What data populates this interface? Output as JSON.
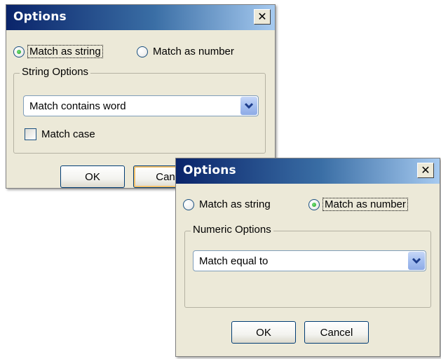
{
  "dialog_string": {
    "title": "Options",
    "close_glyph": "✕",
    "radio_string": "Match as string",
    "radio_number": "Match as number",
    "selected": "string",
    "group_label": "String Options",
    "combo_value": "Match contains word",
    "checkbox_label": "Match case",
    "checkbox_checked": false,
    "ok_label": "OK",
    "cancel_label_visible": "Can"
  },
  "dialog_number": {
    "title": "Options",
    "close_glyph": "✕",
    "radio_string": "Match as string",
    "radio_number": "Match as number",
    "selected": "number",
    "group_label": "Numeric Options",
    "combo_value": "Match equal to",
    "ok_label": "OK",
    "cancel_label": "Cancel"
  },
  "colors": {
    "title_start": "#0a246a",
    "title_end": "#a6caf0",
    "dialog_bg": "#ece9d8",
    "radio_dot": "#21a121",
    "default_button_ring": "#f4c26c"
  },
  "icons": {
    "close": "close-icon",
    "dropdown": "chevron-down-icon"
  }
}
